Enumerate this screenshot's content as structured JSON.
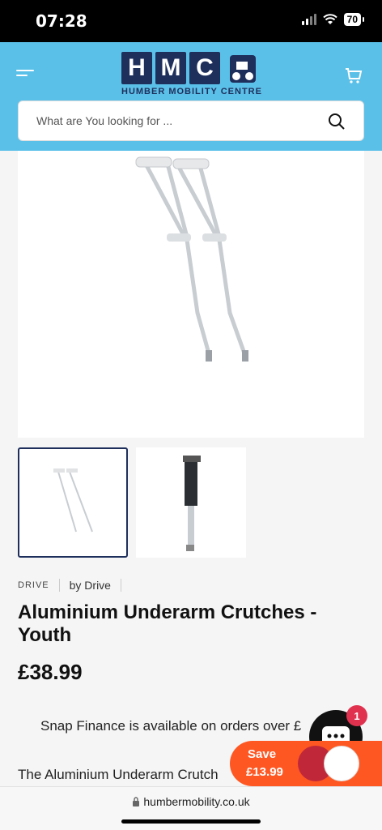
{
  "status": {
    "time": "07:28",
    "battery": "70"
  },
  "header": {
    "logo_letters": [
      "H",
      "M",
      "C"
    ],
    "logo_subtitle": "HUMBER MOBILITY CENTRE",
    "search_placeholder": "What are You looking for ..."
  },
  "product": {
    "brand_code": "DRIVE",
    "brand_by": "by Drive",
    "title": "Aluminium Underarm Crutches - Youth",
    "price": "£38.99",
    "snap_text": "Snap Finance is available on orders over £",
    "description_start": "The Aluminium Underarm Crutch"
  },
  "widgets": {
    "chat_badge": "1",
    "save_label": "Save",
    "save_price": "£13.99"
  },
  "browser": {
    "url": "humbermobility.co.uk"
  },
  "colors": {
    "header_bg": "#5bc0e8",
    "logo_navy": "#1e2f5c",
    "save_orange": "#ff5722"
  }
}
